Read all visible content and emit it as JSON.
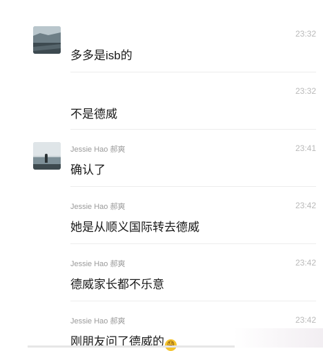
{
  "messages": [
    {
      "sender": "",
      "time": "23:32",
      "text": "多多是isb的",
      "avatar": "landscape-photo",
      "emoji": ""
    },
    {
      "sender": "",
      "time": "23:32",
      "text": "不是德威",
      "avatar": "",
      "emoji": ""
    },
    {
      "sender": "Jessie Hao 郝爽",
      "time": "23:41",
      "text": "确认了",
      "avatar": "person-photo",
      "emoji": ""
    },
    {
      "sender": "Jessie Hao 郝爽",
      "time": "23:42",
      "text": "她是从顺义国际转去德威",
      "avatar": "",
      "emoji": ""
    },
    {
      "sender": "Jessie Hao 郝爽",
      "time": "23:42",
      "text": "德威家长都不乐意",
      "avatar": "",
      "emoji": ""
    },
    {
      "sender": "Jessie Hao 郝爽",
      "time": "23:42",
      "text": "刚朋友问了德威的",
      "avatar": "",
      "emoji": "😓"
    }
  ]
}
